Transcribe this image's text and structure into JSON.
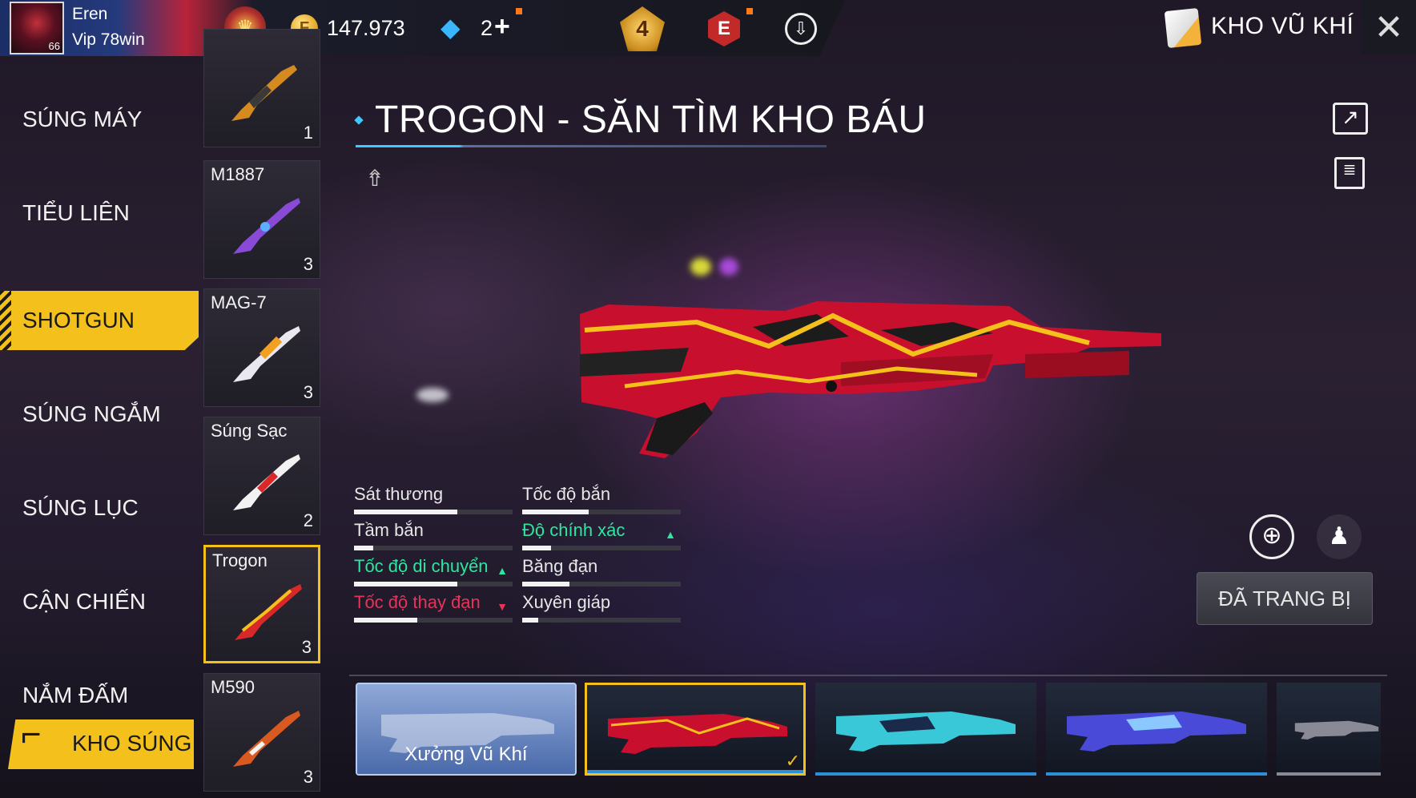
{
  "player": {
    "name": "Eren",
    "subtitle": "Vip  78win",
    "level": "66"
  },
  "currencies": {
    "gold": "147.973",
    "diamonds": "2",
    "add_label": "+"
  },
  "badges": {
    "rank_level": "4",
    "elite_letter": "E"
  },
  "header": {
    "title": "KHO VŨ KHÍ",
    "close_label": "✕"
  },
  "categories": [
    {
      "label": "SÚNG MÁY"
    },
    {
      "label": "TIỂU LIÊN"
    },
    {
      "label": "SHOTGUN",
      "active": true
    },
    {
      "label": "SÚNG NGẮM"
    },
    {
      "label": "SÚNG LỤC"
    },
    {
      "label": "CẬN CHIẾN"
    },
    {
      "label": "NẮM ĐẤM"
    }
  ],
  "gun_locker": {
    "label": "KHO SÚNG"
  },
  "weapons": [
    {
      "name": "",
      "count": "1"
    },
    {
      "name": "M1887",
      "count": "3"
    },
    {
      "name": "MAG-7",
      "count": "3"
    },
    {
      "name": "Súng Sạc",
      "count": "2"
    },
    {
      "name": "Trogon",
      "count": "3",
      "selected": true
    },
    {
      "name": "M590",
      "count": "3"
    }
  ],
  "skin": {
    "title": "TROGON - SĂN TÌM KHO BÁU"
  },
  "stats": [
    {
      "label": "Sát thương",
      "value": 0.65,
      "trend": "none"
    },
    {
      "label": "Tốc độ bắn",
      "value": 0.42,
      "trend": "none"
    },
    {
      "label": "Tầm bắn",
      "value": 0.12,
      "trend": "none"
    },
    {
      "label": "Độ chính xác",
      "value": 0.18,
      "trend": "up",
      "arrow": "▲"
    },
    {
      "label": "Tốc độ di chuyển",
      "value": 0.65,
      "trend": "up",
      "arrow": "▲"
    },
    {
      "label": "Băng đạn",
      "value": 0.3,
      "trend": "none"
    },
    {
      "label": "Tốc độ thay đạn",
      "value": 0.4,
      "trend": "down",
      "arrow": "▼"
    },
    {
      "label": "Xuyên giáp",
      "value": 0.1,
      "trend": "none"
    }
  ],
  "actions": {
    "equipped_label": "ĐÃ TRANG BỊ",
    "zoom_label": "⊕",
    "pose_label": "♟"
  },
  "skin_strip": [
    {
      "label": "Xưởng Vũ Khí",
      "type": "workshop"
    },
    {
      "label": "",
      "type": "skin",
      "selected": true,
      "check": "✓"
    },
    {
      "label": "",
      "type": "skin"
    },
    {
      "label": "",
      "type": "skin"
    },
    {
      "label": "",
      "type": "skin"
    }
  ],
  "colors": {
    "accent_yellow": "#f3c01c",
    "accent_cyan": "#3fc7ff",
    "stat_up": "#2ee6a0",
    "stat_down": "#e8335a"
  }
}
